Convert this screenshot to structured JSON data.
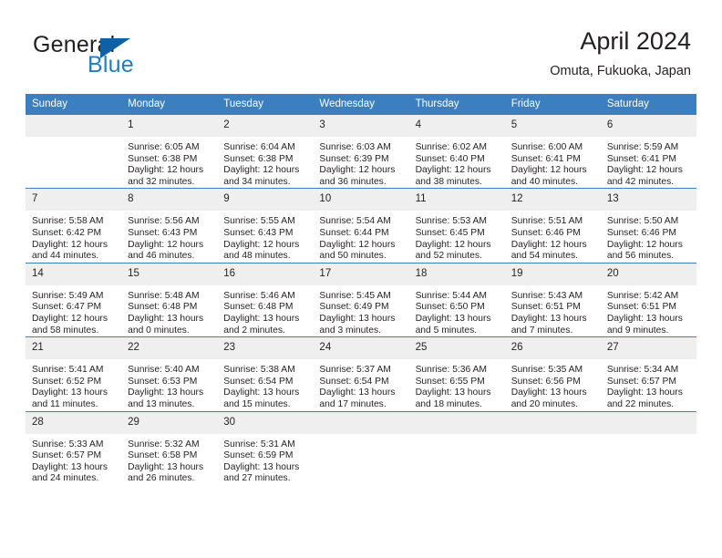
{
  "brand": {
    "name_line1": "General",
    "name_line2": "Blue",
    "accent_color": "#1160a4",
    "blue_text_color": "#1f7ec4",
    "triangle_icon": "triangle-icon"
  },
  "header": {
    "title": "April 2024",
    "subtitle": "Omuta, Fukuoka, Japan"
  },
  "theme": {
    "header_row_bg": "#3c7fc1",
    "daynum_bg": "#efefef",
    "text_color": "#231f20"
  },
  "weekdays": [
    "Sunday",
    "Monday",
    "Tuesday",
    "Wednesday",
    "Thursday",
    "Friday",
    "Saturday"
  ],
  "weeks": [
    [
      {
        "day": "",
        "sunrise": "",
        "sunset": "",
        "daylight_line1": "",
        "daylight_line2": ""
      },
      {
        "day": "1",
        "sunrise": "Sunrise: 6:05 AM",
        "sunset": "Sunset: 6:38 PM",
        "daylight_line1": "Daylight: 12 hours",
        "daylight_line2": "and 32 minutes."
      },
      {
        "day": "2",
        "sunrise": "Sunrise: 6:04 AM",
        "sunset": "Sunset: 6:38 PM",
        "daylight_line1": "Daylight: 12 hours",
        "daylight_line2": "and 34 minutes."
      },
      {
        "day": "3",
        "sunrise": "Sunrise: 6:03 AM",
        "sunset": "Sunset: 6:39 PM",
        "daylight_line1": "Daylight: 12 hours",
        "daylight_line2": "and 36 minutes."
      },
      {
        "day": "4",
        "sunrise": "Sunrise: 6:02 AM",
        "sunset": "Sunset: 6:40 PM",
        "daylight_line1": "Daylight: 12 hours",
        "daylight_line2": "and 38 minutes."
      },
      {
        "day": "5",
        "sunrise": "Sunrise: 6:00 AM",
        "sunset": "Sunset: 6:41 PM",
        "daylight_line1": "Daylight: 12 hours",
        "daylight_line2": "and 40 minutes."
      },
      {
        "day": "6",
        "sunrise": "Sunrise: 5:59 AM",
        "sunset": "Sunset: 6:41 PM",
        "daylight_line1": "Daylight: 12 hours",
        "daylight_line2": "and 42 minutes."
      }
    ],
    [
      {
        "day": "7",
        "sunrise": "Sunrise: 5:58 AM",
        "sunset": "Sunset: 6:42 PM",
        "daylight_line1": "Daylight: 12 hours",
        "daylight_line2": "and 44 minutes."
      },
      {
        "day": "8",
        "sunrise": "Sunrise: 5:56 AM",
        "sunset": "Sunset: 6:43 PM",
        "daylight_line1": "Daylight: 12 hours",
        "daylight_line2": "and 46 minutes."
      },
      {
        "day": "9",
        "sunrise": "Sunrise: 5:55 AM",
        "sunset": "Sunset: 6:43 PM",
        "daylight_line1": "Daylight: 12 hours",
        "daylight_line2": "and 48 minutes."
      },
      {
        "day": "10",
        "sunrise": "Sunrise: 5:54 AM",
        "sunset": "Sunset: 6:44 PM",
        "daylight_line1": "Daylight: 12 hours",
        "daylight_line2": "and 50 minutes."
      },
      {
        "day": "11",
        "sunrise": "Sunrise: 5:53 AM",
        "sunset": "Sunset: 6:45 PM",
        "daylight_line1": "Daylight: 12 hours",
        "daylight_line2": "and 52 minutes."
      },
      {
        "day": "12",
        "sunrise": "Sunrise: 5:51 AM",
        "sunset": "Sunset: 6:46 PM",
        "daylight_line1": "Daylight: 12 hours",
        "daylight_line2": "and 54 minutes."
      },
      {
        "day": "13",
        "sunrise": "Sunrise: 5:50 AM",
        "sunset": "Sunset: 6:46 PM",
        "daylight_line1": "Daylight: 12 hours",
        "daylight_line2": "and 56 minutes."
      }
    ],
    [
      {
        "day": "14",
        "sunrise": "Sunrise: 5:49 AM",
        "sunset": "Sunset: 6:47 PM",
        "daylight_line1": "Daylight: 12 hours",
        "daylight_line2": "and 58 minutes."
      },
      {
        "day": "15",
        "sunrise": "Sunrise: 5:48 AM",
        "sunset": "Sunset: 6:48 PM",
        "daylight_line1": "Daylight: 13 hours",
        "daylight_line2": "and 0 minutes."
      },
      {
        "day": "16",
        "sunrise": "Sunrise: 5:46 AM",
        "sunset": "Sunset: 6:48 PM",
        "daylight_line1": "Daylight: 13 hours",
        "daylight_line2": "and 2 minutes."
      },
      {
        "day": "17",
        "sunrise": "Sunrise: 5:45 AM",
        "sunset": "Sunset: 6:49 PM",
        "daylight_line1": "Daylight: 13 hours",
        "daylight_line2": "and 3 minutes."
      },
      {
        "day": "18",
        "sunrise": "Sunrise: 5:44 AM",
        "sunset": "Sunset: 6:50 PM",
        "daylight_line1": "Daylight: 13 hours",
        "daylight_line2": "and 5 minutes."
      },
      {
        "day": "19",
        "sunrise": "Sunrise: 5:43 AM",
        "sunset": "Sunset: 6:51 PM",
        "daylight_line1": "Daylight: 13 hours",
        "daylight_line2": "and 7 minutes."
      },
      {
        "day": "20",
        "sunrise": "Sunrise: 5:42 AM",
        "sunset": "Sunset: 6:51 PM",
        "daylight_line1": "Daylight: 13 hours",
        "daylight_line2": "and 9 minutes."
      }
    ],
    [
      {
        "day": "21",
        "sunrise": "Sunrise: 5:41 AM",
        "sunset": "Sunset: 6:52 PM",
        "daylight_line1": "Daylight: 13 hours",
        "daylight_line2": "and 11 minutes."
      },
      {
        "day": "22",
        "sunrise": "Sunrise: 5:40 AM",
        "sunset": "Sunset: 6:53 PM",
        "daylight_line1": "Daylight: 13 hours",
        "daylight_line2": "and 13 minutes."
      },
      {
        "day": "23",
        "sunrise": "Sunrise: 5:38 AM",
        "sunset": "Sunset: 6:54 PM",
        "daylight_line1": "Daylight: 13 hours",
        "daylight_line2": "and 15 minutes."
      },
      {
        "day": "24",
        "sunrise": "Sunrise: 5:37 AM",
        "sunset": "Sunset: 6:54 PM",
        "daylight_line1": "Daylight: 13 hours",
        "daylight_line2": "and 17 minutes."
      },
      {
        "day": "25",
        "sunrise": "Sunrise: 5:36 AM",
        "sunset": "Sunset: 6:55 PM",
        "daylight_line1": "Daylight: 13 hours",
        "daylight_line2": "and 18 minutes."
      },
      {
        "day": "26",
        "sunrise": "Sunrise: 5:35 AM",
        "sunset": "Sunset: 6:56 PM",
        "daylight_line1": "Daylight: 13 hours",
        "daylight_line2": "and 20 minutes."
      },
      {
        "day": "27",
        "sunrise": "Sunrise: 5:34 AM",
        "sunset": "Sunset: 6:57 PM",
        "daylight_line1": "Daylight: 13 hours",
        "daylight_line2": "and 22 minutes."
      }
    ],
    [
      {
        "day": "28",
        "sunrise": "Sunrise: 5:33 AM",
        "sunset": "Sunset: 6:57 PM",
        "daylight_line1": "Daylight: 13 hours",
        "daylight_line2": "and 24 minutes."
      },
      {
        "day": "29",
        "sunrise": "Sunrise: 5:32 AM",
        "sunset": "Sunset: 6:58 PM",
        "daylight_line1": "Daylight: 13 hours",
        "daylight_line2": "and 26 minutes."
      },
      {
        "day": "30",
        "sunrise": "Sunrise: 5:31 AM",
        "sunset": "Sunset: 6:59 PM",
        "daylight_line1": "Daylight: 13 hours",
        "daylight_line2": "and 27 minutes."
      },
      {
        "day": "",
        "sunrise": "",
        "sunset": "",
        "daylight_line1": "",
        "daylight_line2": ""
      },
      {
        "day": "",
        "sunrise": "",
        "sunset": "",
        "daylight_line1": "",
        "daylight_line2": ""
      },
      {
        "day": "",
        "sunrise": "",
        "sunset": "",
        "daylight_line1": "",
        "daylight_line2": ""
      },
      {
        "day": "",
        "sunrise": "",
        "sunset": "",
        "daylight_line1": "",
        "daylight_line2": ""
      }
    ]
  ]
}
